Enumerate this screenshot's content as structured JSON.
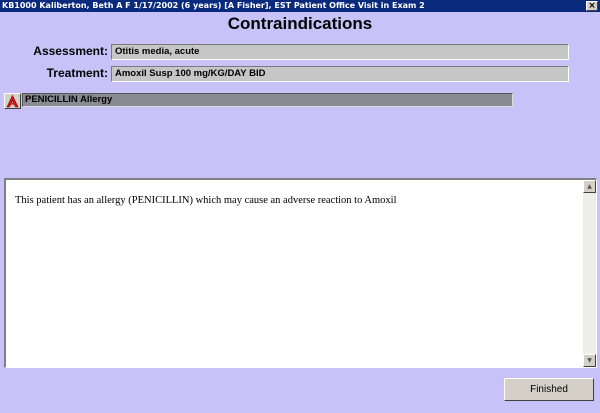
{
  "window": {
    "title": "KB1000 Kaliberton, Beth A  F  1/17/2002 (6 years)  [A Fisher], EST Patient Office Visit in Exam 2",
    "close_glyph": "×"
  },
  "heading": "Contraindications",
  "assessment": {
    "label": "Assessment:",
    "value": "Otitis media, acute"
  },
  "treatment": {
    "label": "Treatment:",
    "value": "Amoxil Susp 100 mg/KG/DAY  BID"
  },
  "alert": {
    "icon": "allergy-alert-icon",
    "text": "PENICILLIN Allergy"
  },
  "message": {
    "text": "This patient has an allergy (PENICILLIN) which may cause an adverse reaction to Amoxil"
  },
  "scrollbar": {
    "up": "▲",
    "down": "▼"
  },
  "finished_label": "Finished",
  "colors": {
    "background": "#c8c2f8",
    "titlebar": "#0a2a7e",
    "alert_icon_red": "#d01818"
  }
}
